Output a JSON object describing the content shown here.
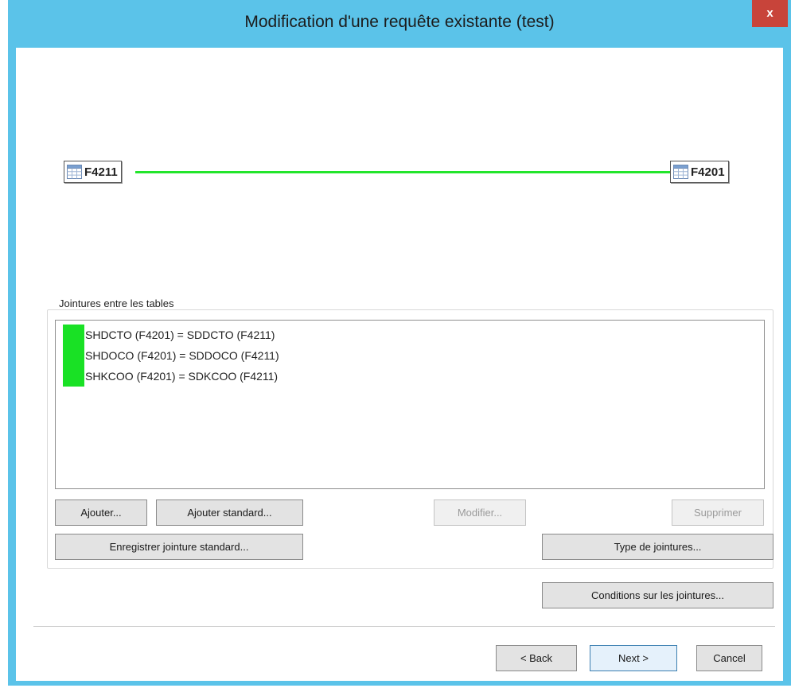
{
  "window": {
    "title": "Modification d'une requête existante (test)",
    "close_glyph": "x"
  },
  "diagram": {
    "left_table": "F4211",
    "right_table": "F4201",
    "link_color": "#22e52b"
  },
  "joins": {
    "group_label": "Jointures entre les tables",
    "marker_color": "#19e125",
    "items": [
      "SHDCTO (F4201) = SDDCTO (F4211)",
      "SHDOCO (F4201) = SDDOCO (F4211)",
      "SHKCOO (F4201) = SDKCOO (F4211)"
    ]
  },
  "buttons": {
    "add": "Ajouter...",
    "add_standard": "Ajouter standard...",
    "modify": "Modifier...",
    "delete": "Supprimer",
    "save_standard": "Enregistrer jointure standard...",
    "join_type": "Type de jointures...",
    "join_conditions": "Conditions sur les jointures...",
    "back": "< Back",
    "next": "Next >",
    "cancel": "Cancel"
  },
  "colors": {
    "titlebar": "#5bc3e9",
    "close": "#c8443a"
  }
}
